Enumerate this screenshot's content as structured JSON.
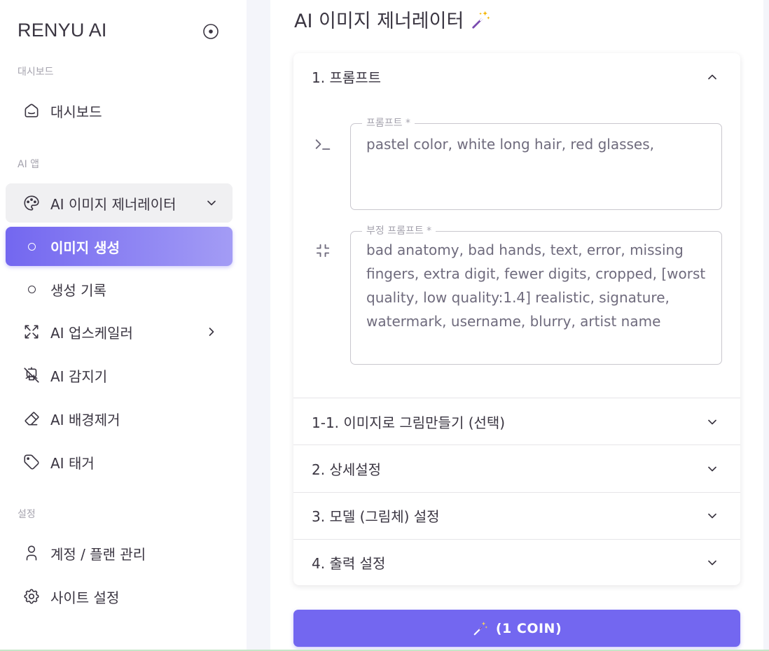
{
  "sidebar": {
    "brand": "RENYU AI",
    "sections": {
      "dashboard": "대시보드",
      "ai_apps": "AI 앱",
      "settings": "설정"
    },
    "items": {
      "dashboard": "대시보드",
      "image_generator": "AI 이미지 제너레이터",
      "generate_image": "이미지 생성",
      "history": "생성 기록",
      "upscaler": "AI 업스케일러",
      "detector": "AI 감지기",
      "bg_remover": "AI 배경제거",
      "tagger": "AI 태거",
      "account": "계정 / 플랜 관리",
      "site_settings": "사이트 설정"
    }
  },
  "main": {
    "title": "AI 이미지 제너레이터",
    "sections": {
      "prompt": "1. 프롬프트",
      "img2img": "1-1. 이미지로 그림만들기 (선택)",
      "detail": "2. 상세설정",
      "model": "3. 모델 (그림체) 설정",
      "output": "4. 출력 설정"
    },
    "prompt_field": {
      "label": "프롬프트 *",
      "value": "pastel color, white long hair, red glasses,"
    },
    "negative_field": {
      "label": "부정 프롬프트 *",
      "value": "bad anatomy, bad hands, text, error, missing fingers, extra digit, fewer digits, cropped, [worst quality, low quality:1.4] realistic, signature, watermark, username, blurry, artist name"
    },
    "generate_button": "(1 COIN)"
  },
  "colors": {
    "accent": "#7367f0",
    "accent_light": "#a39cf5",
    "text": "#3a3541",
    "muted": "#a5a3ae"
  },
  "icons": {
    "brand_toggle": "radio-circle-icon",
    "dashboard": "smart-home-icon",
    "image_generator": "palette-icon",
    "upscaler": "arrows-maximize-icon",
    "detector": "robot-off-icon",
    "bg_remover": "eraser-icon",
    "tagger": "tag-icon",
    "account": "user-icon",
    "site_settings": "settings-icon",
    "prompt": "terminal-prompt-icon",
    "negative": "arrows-minimize-icon",
    "wand": "magic-wand-icon"
  }
}
